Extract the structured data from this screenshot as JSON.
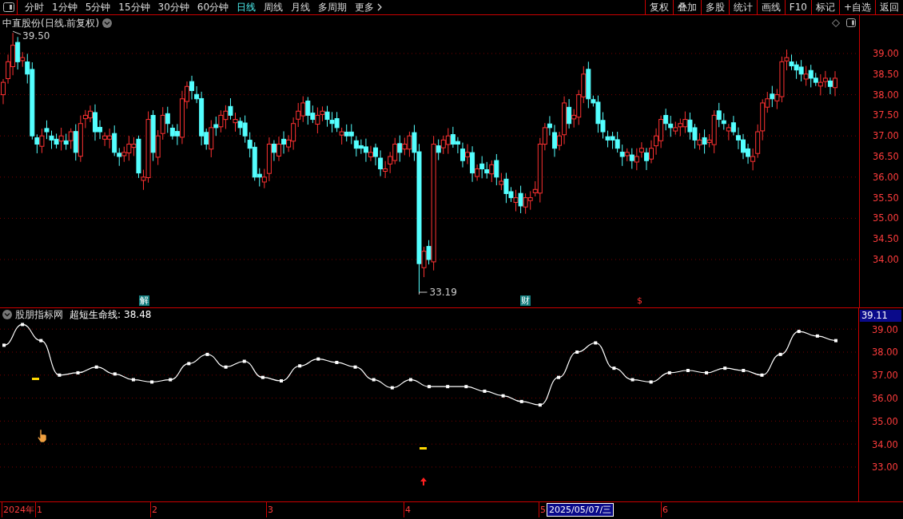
{
  "toolbar": {
    "period_tabs": [
      {
        "label": "分时",
        "selected": false
      },
      {
        "label": "1分钟",
        "selected": false
      },
      {
        "label": "5分钟",
        "selected": false
      },
      {
        "label": "15分钟",
        "selected": false
      },
      {
        "label": "30分钟",
        "selected": false
      },
      {
        "label": "60分钟",
        "selected": false
      },
      {
        "label": "日线",
        "selected": true
      },
      {
        "label": "周线",
        "selected": false
      },
      {
        "label": "月线",
        "selected": false
      },
      {
        "label": "多周期",
        "selected": false
      }
    ],
    "more": "更多",
    "buttons": [
      "复权",
      "叠加",
      "多股",
      "统计",
      "画线",
      "F10",
      "标记",
      "+自选",
      "返回"
    ]
  },
  "main_chart": {
    "title": "中直股份(日线.前复权)",
    "high_label": "39.50",
    "low_label": "33.19",
    "markers": [
      {
        "kind": "tag",
        "text": "解"
      },
      {
        "kind": "tag",
        "text": "财"
      },
      {
        "kind": "symbol",
        "text": "$"
      }
    ],
    "price_axis": [
      "39.00",
      "38.50",
      "38.00",
      "37.50",
      "37.00",
      "36.50",
      "36.00",
      "35.50",
      "35.00",
      "34.50",
      "34.00"
    ]
  },
  "indicator": {
    "source": "股朋指标网",
    "name": "超短生命线:",
    "value": "38.48",
    "current_value": "39.11",
    "chart_data": {
      "type": "line",
      "ylim": [
        31.47,
        39.91
      ],
      "grid": true,
      "yticks": [
        {
          "value": 39,
          "label": "39.00"
        },
        {
          "value": 38,
          "label": "38.00"
        },
        {
          "value": 37,
          "label": "37.00"
        },
        {
          "value": 36,
          "label": "36.00"
        },
        {
          "value": 35,
          "label": "35.00"
        },
        {
          "value": 34,
          "label": "34.00"
        },
        {
          "value": 33,
          "label": "33.00"
        }
      ],
      "series": [
        {
          "color": "#ffffff",
          "marker": "square",
          "values": [
            38.3,
            39.2,
            38.5,
            37.0,
            37.1,
            37.35,
            37.05,
            36.8,
            36.7,
            36.8,
            37.5,
            37.9,
            37.35,
            37.6,
            36.9,
            36.75,
            37.4,
            37.7,
            37.55,
            37.35,
            36.8,
            36.45,
            36.8,
            36.5,
            36.5,
            36.5,
            36.3,
            36.1,
            35.85,
            35.7,
            36.9,
            38.0,
            38.4,
            37.3,
            36.8,
            36.7,
            37.1,
            37.2,
            37.1,
            37.3,
            37.2,
            37.0,
            37.9,
            38.9,
            38.7,
            38.5
          ]
        }
      ]
    }
  },
  "time_axis": [
    {
      "label": "2024年",
      "selected": false
    },
    {
      "label": "1",
      "selected": false
    },
    {
      "label": "2",
      "selected": false
    },
    {
      "label": "3",
      "selected": false
    },
    {
      "label": "4",
      "selected": false
    },
    {
      "label": "5",
      "selected": false
    },
    {
      "label": "2025/05/07/三",
      "selected": true
    },
    {
      "label": "6",
      "selected": false
    }
  ]
}
